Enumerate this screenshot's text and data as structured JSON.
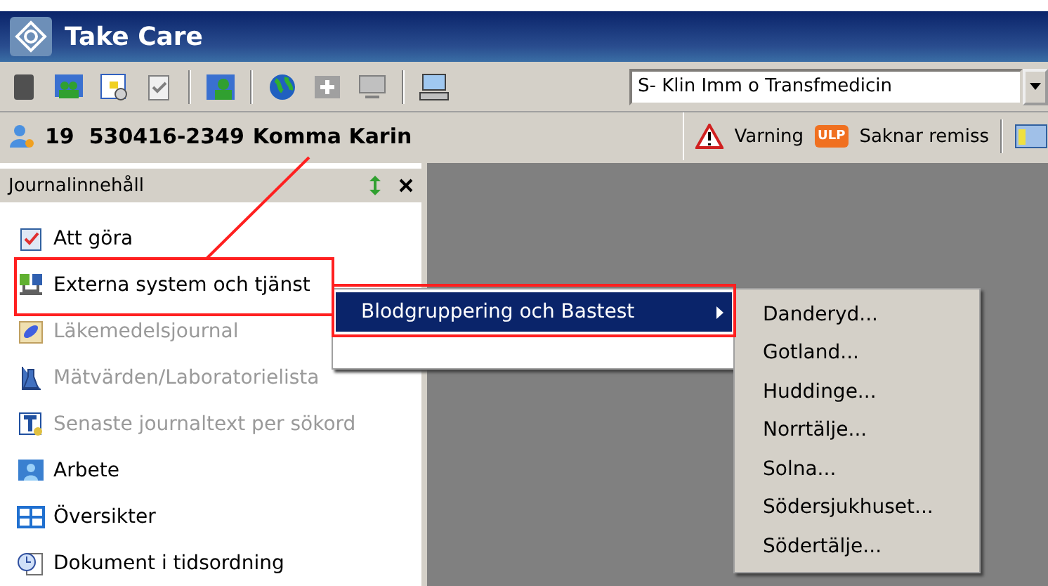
{
  "window": {
    "title": "Take Care"
  },
  "toolbar": {
    "unit_select": {
      "value": "S- Klin Imm o Transfmedicin"
    }
  },
  "patient": {
    "id": "19  530416-2349",
    "name": "Komma Karin"
  },
  "alerts": [
    {
      "kind": "warning",
      "label": "Varning"
    },
    {
      "kind": "ulp",
      "badge": "ULP",
      "label": "Saknar remiss"
    }
  ],
  "panel": {
    "title": "Journalinnehåll",
    "items": [
      {
        "label": "Att göra",
        "disabled": false,
        "kind": "clipboard"
      },
      {
        "label": "Externa system och tjänst",
        "disabled": false,
        "kind": "network"
      },
      {
        "label": "Läkemedelsjournal",
        "disabled": true,
        "kind": "pill"
      },
      {
        "label": "Mätvärden/Laboratorielista",
        "disabled": true,
        "kind": "flask"
      },
      {
        "label": "Senaste journaltext per sökord",
        "disabled": true,
        "kind": "text"
      },
      {
        "label": "Arbete",
        "disabled": false,
        "kind": "person"
      },
      {
        "label": "Översikter",
        "disabled": false,
        "kind": "grid"
      },
      {
        "label": "Dokument i tidsordning",
        "disabled": false,
        "kind": "clock"
      }
    ]
  },
  "menu": {
    "items": [
      {
        "label": "Blodgruppering och Bastest",
        "selected": true
      }
    ]
  },
  "submenu": {
    "items": [
      "Danderyd...",
      "Gotland...",
      "Huddinge...",
      "Norrtälje...",
      "Solna...",
      "Södersjukhuset...",
      "Södertälje..."
    ]
  }
}
